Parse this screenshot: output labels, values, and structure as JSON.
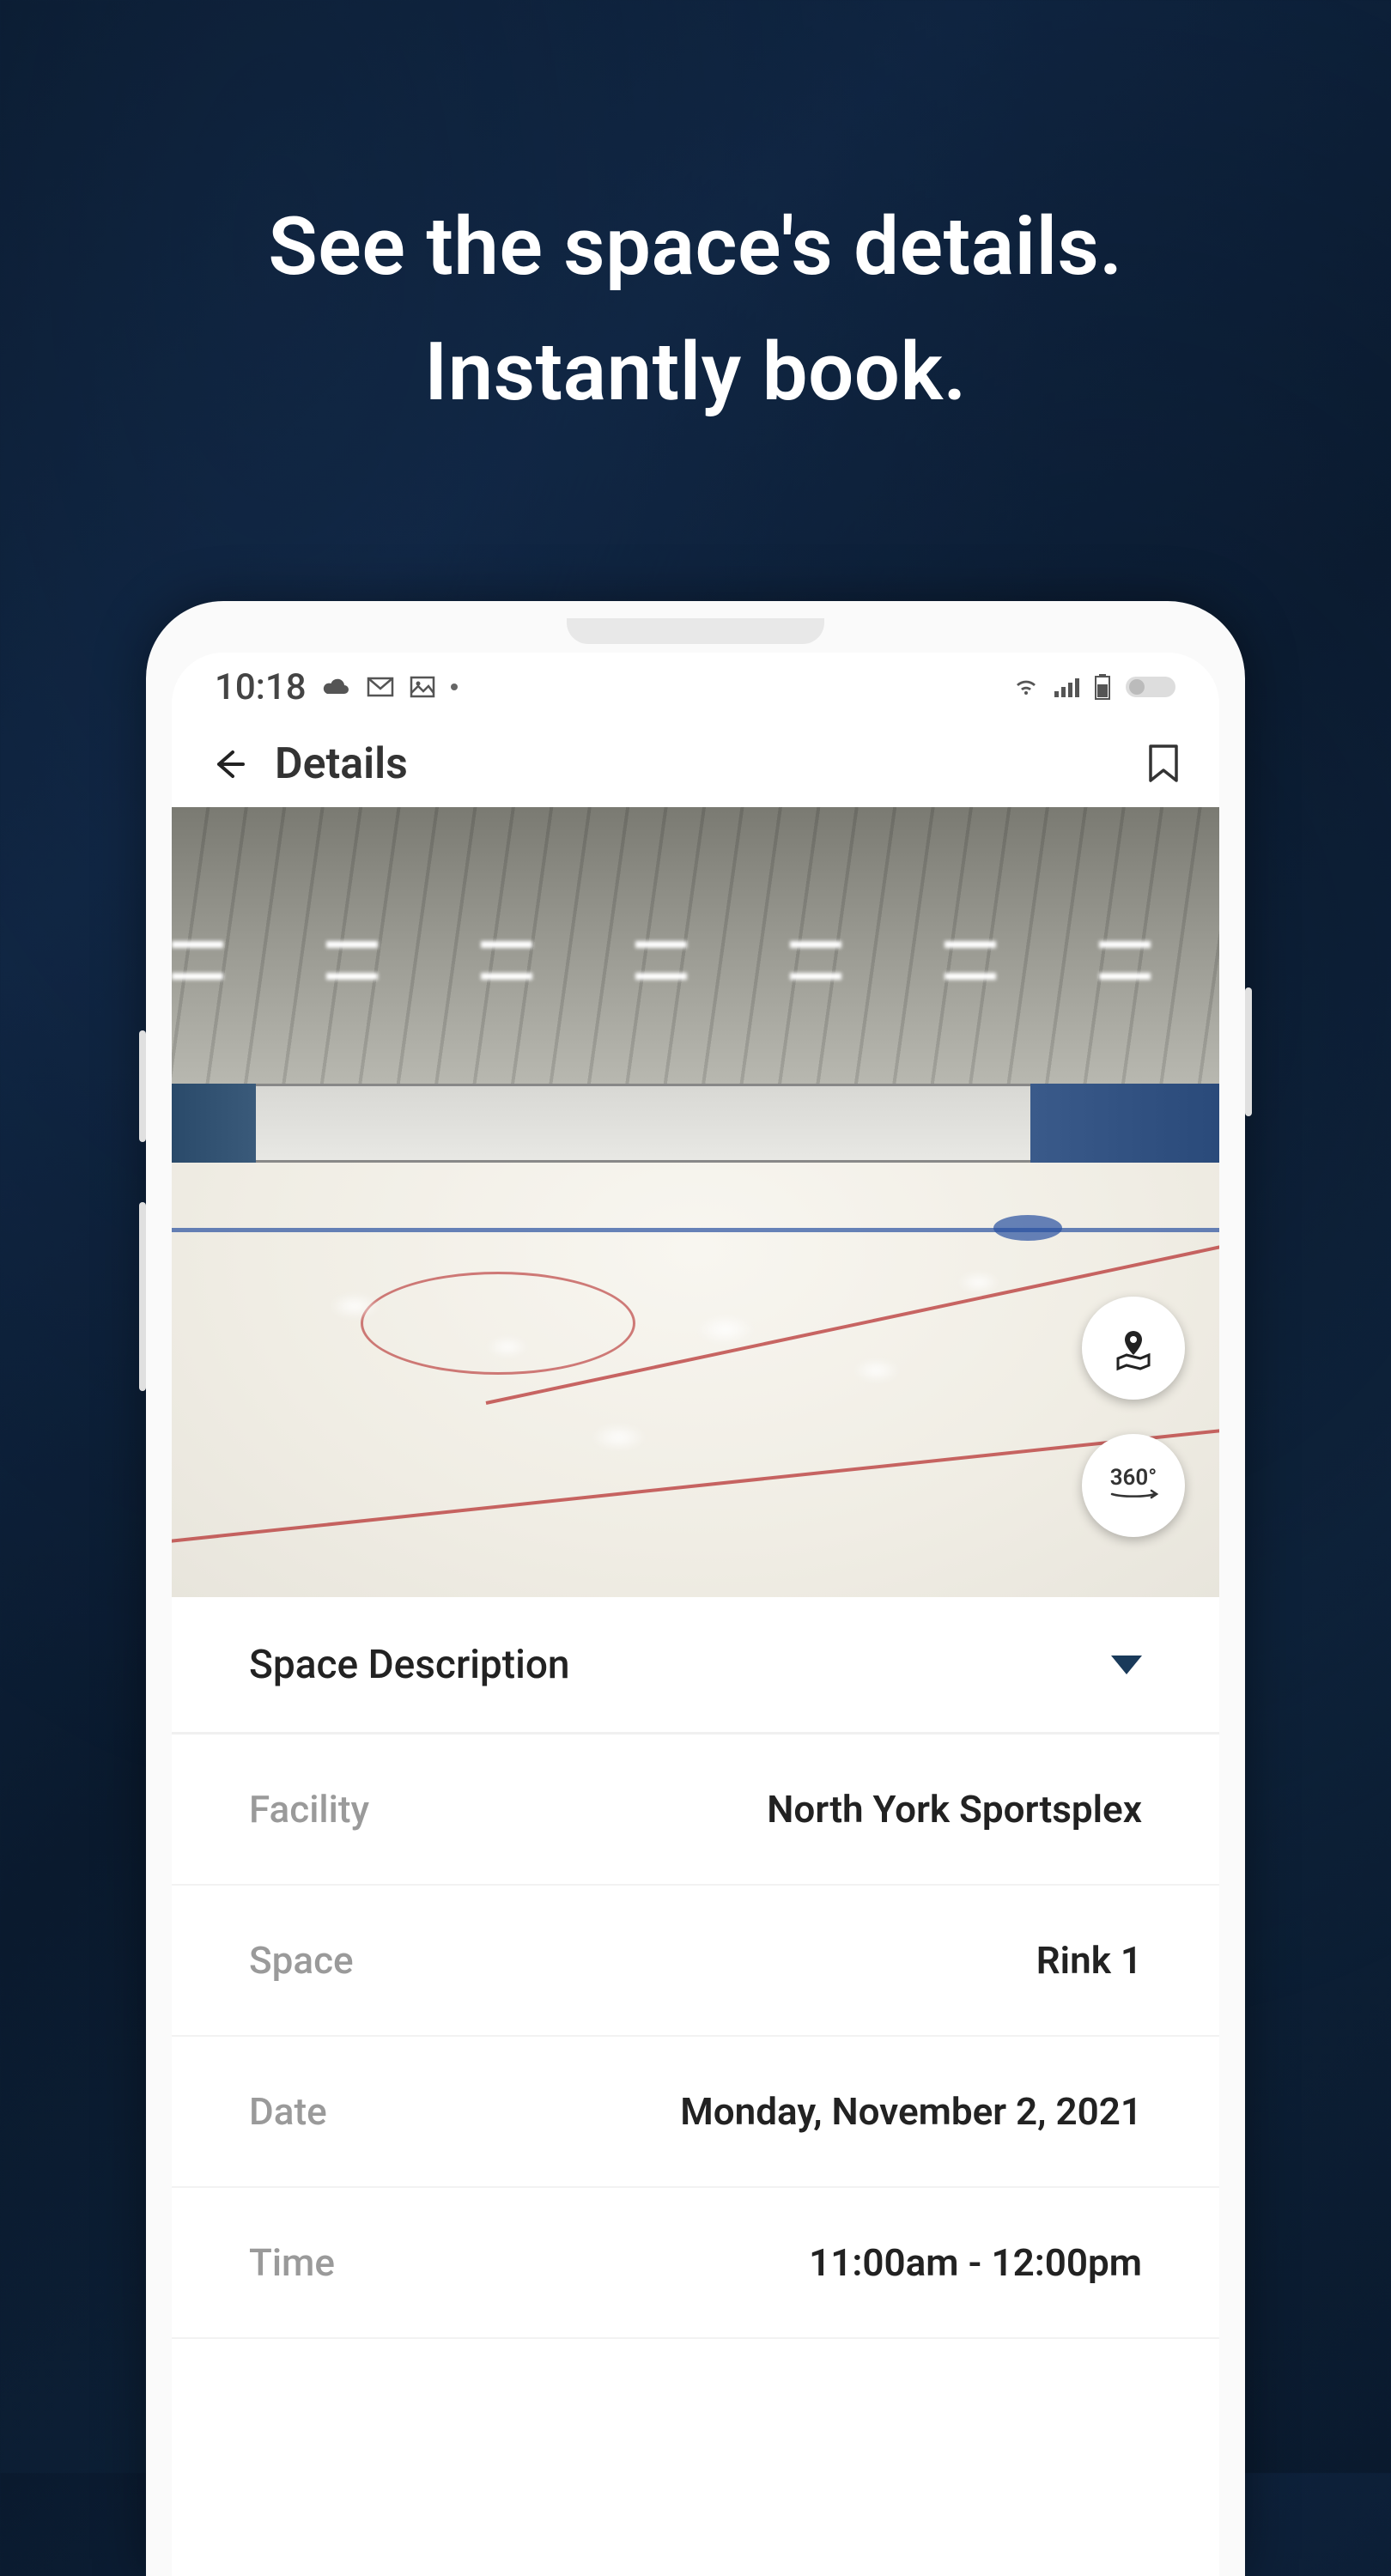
{
  "marketing": {
    "headline_line1": "See the space's details.",
    "headline_line2": "Instantly book."
  },
  "statusBar": {
    "time": "10:18"
  },
  "appBar": {
    "title": "Details"
  },
  "accordion": {
    "title": "Space Description"
  },
  "details": {
    "facility": {
      "label": "Facility",
      "value": "North York Sportsplex"
    },
    "space": {
      "label": "Space",
      "value": "Rink 1"
    },
    "date": {
      "label": "Date",
      "value": "Monday, November 2, 2021"
    },
    "time": {
      "label": "Time",
      "value": "11:00am - 12:00pm"
    }
  },
  "fab": {
    "view360": "360°"
  }
}
